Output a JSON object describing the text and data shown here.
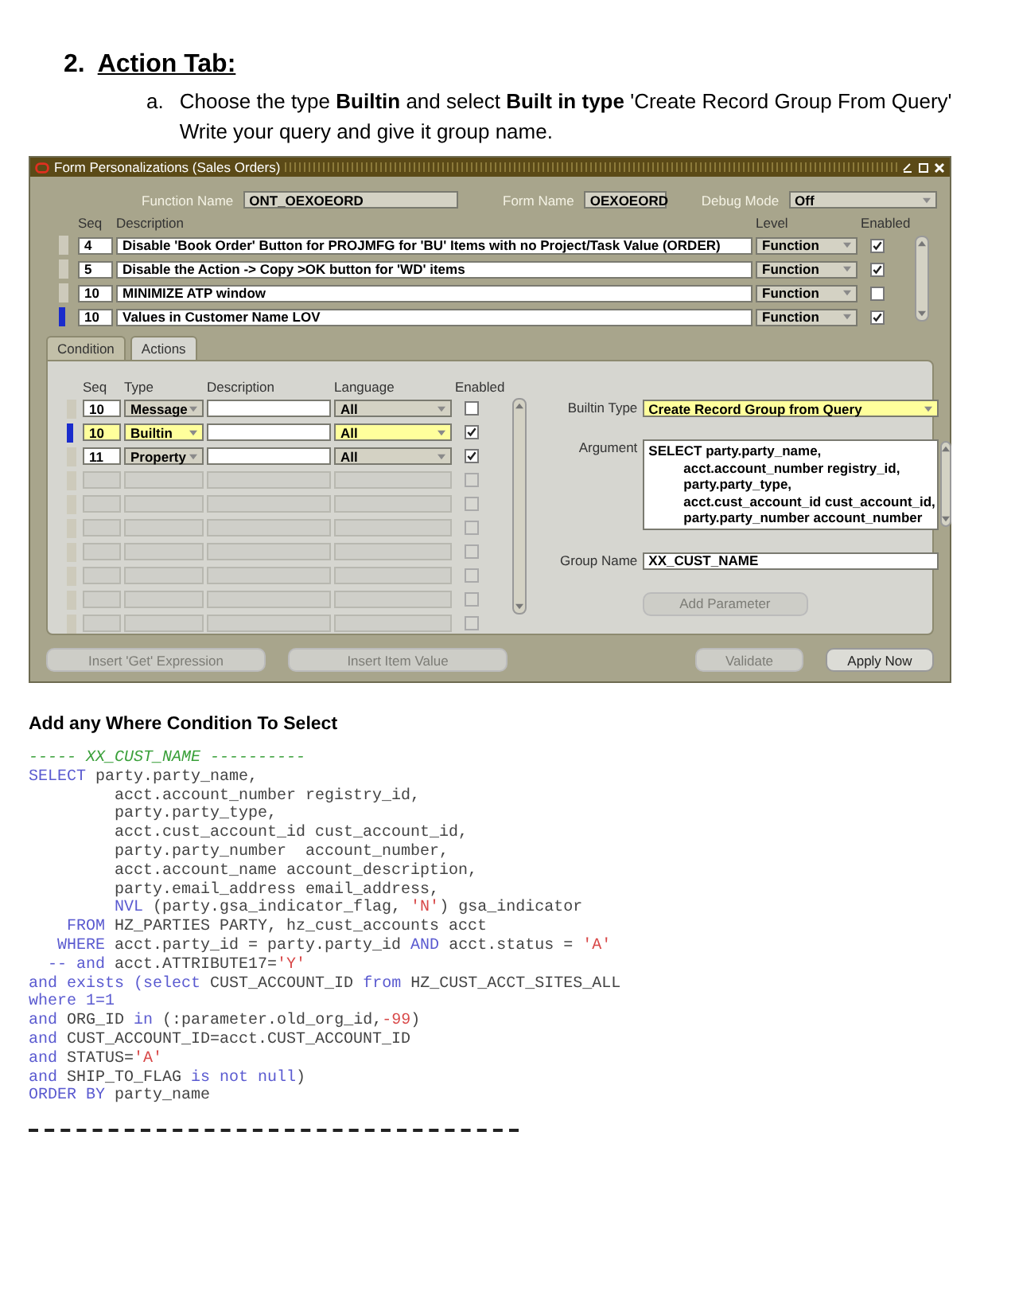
{
  "heading": {
    "number": "2.",
    "text": "Action Tab:"
  },
  "step": {
    "marker": "a.",
    "lines": [
      "Choose the type **Builtin** and select **Built in type** 'Create Record Group From Query'",
      "Write your query and give it group name."
    ]
  },
  "window": {
    "title": "Form Personalizations (Sales Orders)",
    "function_name_label": "Function Name",
    "function_name": "ONT_OEXOEORD",
    "form_name_label": "Form Name",
    "form_name": "OEXOEORD",
    "debug_mode_label": "Debug Mode",
    "debug_mode": "Off",
    "rules": {
      "columns": [
        "Seq",
        "Description",
        "Level",
        "Enabled"
      ],
      "rows": [
        {
          "seq": "4",
          "description": "Disable 'Book Order' Button for PROJMFG for 'BU' Items with no Project/Task Value (ORDER)",
          "level": "Function",
          "enabled": true,
          "selected": false
        },
        {
          "seq": "5",
          "description": "Disable the Action -> Copy >OK button for 'WD' items",
          "level": "Function",
          "enabled": true,
          "selected": false
        },
        {
          "seq": "10",
          "description": "MINIMIZE ATP window",
          "level": "Function",
          "enabled": false,
          "selected": false
        },
        {
          "seq": "10",
          "description": "Values in Customer Name LOV",
          "level": "Function",
          "enabled": true,
          "selected": true
        }
      ]
    },
    "tabs": [
      {
        "label": "Condition",
        "selected": false
      },
      {
        "label": "Actions",
        "selected": true
      }
    ],
    "actions": {
      "columns": [
        "Seq",
        "Type",
        "Description",
        "Language",
        "Enabled"
      ],
      "rows": [
        {
          "kind": "filled",
          "seq": "10",
          "type": "Message",
          "language": "All",
          "enabled": false,
          "selected": false
        },
        {
          "kind": "filled",
          "seq": "10",
          "type": "Builtin",
          "language": "All",
          "enabled": true,
          "selected": true
        },
        {
          "kind": "filled",
          "seq": "11",
          "type": "Property",
          "language": "All",
          "enabled": true,
          "selected": false
        },
        {
          "kind": "empty",
          "enabled": false,
          "selected": false
        },
        {
          "kind": "empty",
          "enabled": false,
          "selected": false
        },
        {
          "kind": "empty",
          "enabled": false,
          "selected": false
        },
        {
          "kind": "empty",
          "enabled": false,
          "selected": false
        },
        {
          "kind": "empty",
          "enabled": false,
          "selected": false
        },
        {
          "kind": "empty",
          "enabled": false,
          "selected": false
        },
        {
          "kind": "empty",
          "enabled": false,
          "selected": false
        }
      ]
    },
    "builtin_type_label": "Builtin Type",
    "builtin_type": "Create Record Group from Query",
    "argument_label": "Argument",
    "argument_lines": [
      "SELECT party.party_name,",
      "acct.account_number registry_id,",
      "party.party_type,",
      "acct.cust_account_id cust_account_id,",
      "party.party_number  account_number"
    ],
    "group_name_label": "Group Name",
    "group_name": "XX_CUST_NAME",
    "add_parameter": {
      "label": "Add Parameter",
      "disabled": true
    },
    "buttons": [
      {
        "label": "Insert 'Get' Expression",
        "disabled": true
      },
      {
        "label": "Insert Item Value",
        "disabled": true
      },
      {
        "label": "Validate",
        "disabled": true
      },
      {
        "label": "Apply Now",
        "disabled": false
      }
    ]
  },
  "note": "Add any Where Condition To Select",
  "code_lines": [
    [
      {
        "kind": "comment",
        "text": "----- XX_CUST_NAME ----------"
      }
    ],
    [
      {
        "kind": "keyword",
        "text": "SELECT"
      },
      {
        "kind": "plain",
        "text": " party.party_name,"
      }
    ],
    [
      {
        "kind": "plain",
        "text": "         acct.account_number registry_id,"
      }
    ],
    [
      {
        "kind": "plain",
        "text": "         party.party_type,"
      }
    ],
    [
      {
        "kind": "plain",
        "text": "         acct.cust_account_id cust_account_id,"
      }
    ],
    [
      {
        "kind": "plain",
        "text": "         party.party_number  account_number,"
      }
    ],
    [
      {
        "kind": "plain",
        "text": "         acct.account_name account_description,"
      }
    ],
    [
      {
        "kind": "plain",
        "text": "         party.email_address email_address,"
      }
    ],
    [
      {
        "kind": "keyword",
        "text": "         NVL"
      },
      {
        "kind": "plain",
        "text": " (party.gsa_indicator_flag, "
      },
      {
        "kind": "string",
        "text": "'N'"
      },
      {
        "kind": "plain",
        "text": ") gsa_indicator"
      }
    ],
    [
      {
        "kind": "keyword",
        "text": "    FROM"
      },
      {
        "kind": "plain",
        "text": " HZ_PARTIES PARTY, hz_cust_accounts acct"
      }
    ],
    [
      {
        "kind": "keyword",
        "text": "   WHERE"
      },
      {
        "kind": "plain",
        "text": " acct.party_id = party.party_id "
      },
      {
        "kind": "keyword",
        "text": "AND"
      },
      {
        "kind": "plain",
        "text": " acct.status = "
      },
      {
        "kind": "string",
        "text": "'A'"
      }
    ],
    [
      {
        "kind": "keyword",
        "text": "  -- and"
      },
      {
        "kind": "plain",
        "text": " acct.ATTRIBUTE17="
      },
      {
        "kind": "string",
        "text": "'Y'"
      }
    ],
    [
      {
        "kind": "keyword",
        "text": "and exists (select"
      },
      {
        "kind": "plain",
        "text": " CUST_ACCOUNT_ID "
      },
      {
        "kind": "keyword",
        "text": "from"
      },
      {
        "kind": "plain",
        "text": " HZ_CUST_ACCT_SITES_ALL"
      }
    ],
    [
      {
        "kind": "keyword",
        "text": "where 1=1"
      }
    ],
    [
      {
        "kind": "keyword",
        "text": "and"
      },
      {
        "kind": "plain",
        "text": " ORG_ID "
      },
      {
        "kind": "keyword",
        "text": "in"
      },
      {
        "kind": "plain",
        "text": " (:parameter.old_org_id,"
      },
      {
        "kind": "string",
        "text": "-99"
      },
      {
        "kind": "plain",
        "text": ")"
      }
    ],
    [
      {
        "kind": "keyword",
        "text": "and"
      },
      {
        "kind": "plain",
        "text": " CUST_ACCOUNT_ID=acct.CUST_ACCOUNT_ID"
      }
    ],
    [
      {
        "kind": "keyword",
        "text": "and"
      },
      {
        "kind": "plain",
        "text": " STATUS="
      },
      {
        "kind": "string",
        "text": "'A'"
      }
    ],
    [
      {
        "kind": "keyword",
        "text": "and"
      },
      {
        "kind": "plain",
        "text": " SHIP_TO_FLAG "
      },
      {
        "kind": "keyword",
        "text": "is not null"
      },
      {
        "kind": "plain",
        "text": ")"
      }
    ],
    [
      {
        "kind": "keyword",
        "text": "ORDER BY"
      },
      {
        "kind": "plain",
        "text": " party_name"
      }
    ]
  ]
}
